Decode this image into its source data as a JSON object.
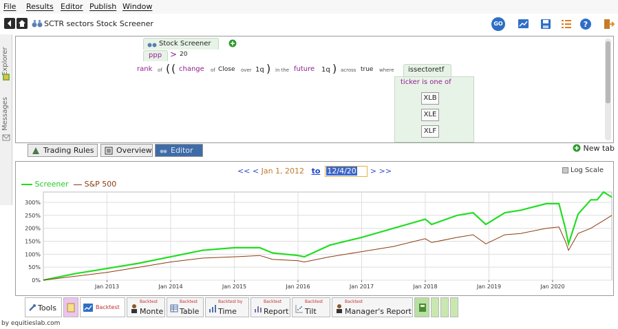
{
  "menu": {
    "items": [
      {
        "label": "File"
      },
      {
        "label": "Results"
      },
      {
        "label": "Editor"
      },
      {
        "label": "Publish"
      },
      {
        "label": "Window"
      }
    ]
  },
  "titlebar": {
    "title": "SCTR sectors Stock Screener",
    "go_label": "GO",
    "icons": [
      "chart-icon",
      "save-icon",
      "list-icon",
      "help-icon",
      "exit-icon"
    ]
  },
  "side_tabs": {
    "explorer": "Explorer",
    "messages": "Messages"
  },
  "editor": {
    "root_label": "Stock Screener",
    "filter_var": "ppp",
    "filter_op": ">",
    "filter_value": "20",
    "rank_word": "rank",
    "of_word": "of",
    "change_word": "change",
    "of_word2": "of",
    "close_word": "Close",
    "over_word": "over",
    "period1": "1q",
    "in_the_word": "in the",
    "future_word": "future",
    "period2": "1q",
    "across_word": "across",
    "true_word": "true",
    "where_word": "where",
    "is_sector_label": "issectoretf",
    "ticker_is_one_of": "ticker is one of",
    "tickers": [
      "XLB",
      "XLE",
      "XLF"
    ]
  },
  "editor_tabs": {
    "trading_rules": "Trading Rules",
    "overview": "Overview",
    "editor": "Editor",
    "new_tab": "New tab",
    "active": "Editor"
  },
  "chart_nav": {
    "prev": "<< <",
    "start_date": "Jan 1, 2012",
    "to": "to",
    "end_date": "12/4/20",
    "next": "> >>",
    "log_scale": "Log Scale"
  },
  "tools_tabs": {
    "tools": "Tools",
    "backtest": "Backtest",
    "items": [
      {
        "caption": "Backtest",
        "label": "Monte"
      },
      {
        "caption": "Backtest",
        "label": "Table"
      },
      {
        "caption": "Backtest by",
        "label": "Time"
      },
      {
        "caption": "Backtest",
        "label": "Report"
      },
      {
        "caption": "Backtest",
        "label": "Tilt"
      },
      {
        "caption": "Backtest",
        "label": "Manager's Report"
      }
    ]
  },
  "credit": "by equitieslab.com",
  "colors": {
    "screener": "#22dd22",
    "sp500": "#8b3a0f",
    "active_tab": "#3f6ca7",
    "purple_text": "#8e1f8e"
  },
  "chart_data": {
    "type": "line",
    "title": "",
    "xlabel": "",
    "ylabel": "",
    "ylim": [
      0,
      340
    ],
    "yticks": [
      "0%",
      "50%",
      "100%",
      "150%",
      "200%",
      "250%",
      "300%"
    ],
    "ytick_values": [
      0,
      50,
      100,
      150,
      200,
      250,
      300
    ],
    "xticks": [
      "Jan 2013",
      "Jan 2014",
      "Jan 2015",
      "Jan 2016",
      "Jan 2017",
      "Jan 2018",
      "Jan 2019",
      "Jan 2020"
    ],
    "xtick_values": [
      2013,
      2014,
      2015,
      2016,
      2017,
      2018,
      2019,
      2020
    ],
    "xlim": [
      2012.0,
      2020.93
    ],
    "grid": true,
    "legend_position": "top-left",
    "series": [
      {
        "name": "Screener",
        "color": "#22dd22",
        "x": [
          2012.0,
          2012.5,
          2013.0,
          2013.5,
          2014.0,
          2014.5,
          2015.0,
          2015.4,
          2015.6,
          2016.0,
          2016.1,
          2016.5,
          2017.0,
          2017.5,
          2018.0,
          2018.1,
          2018.5,
          2018.75,
          2018.95,
          2019.25,
          2019.5,
          2019.9,
          2020.1,
          2020.2,
          2020.25,
          2020.4,
          2020.6,
          2020.7,
          2020.8,
          2020.93
        ],
        "values": [
          0,
          25,
          45,
          65,
          90,
          115,
          125,
          125,
          105,
          95,
          90,
          135,
          165,
          200,
          235,
          215,
          250,
          260,
          215,
          260,
          270,
          295,
          295,
          200,
          140,
          255,
          310,
          310,
          340,
          320
        ]
      },
      {
        "name": "S&P 500",
        "color": "#8b3a0f",
        "x": [
          2012.0,
          2012.5,
          2013.0,
          2013.5,
          2014.0,
          2014.5,
          2015.0,
          2015.4,
          2015.6,
          2016.0,
          2016.1,
          2016.5,
          2017.0,
          2017.5,
          2018.0,
          2018.1,
          2018.5,
          2018.75,
          2018.95,
          2019.25,
          2019.5,
          2019.9,
          2020.1,
          2020.2,
          2020.25,
          2020.4,
          2020.6,
          2020.7,
          2020.8,
          2020.93
        ],
        "values": [
          0,
          15,
          30,
          50,
          70,
          85,
          90,
          95,
          80,
          75,
          70,
          90,
          110,
          130,
          160,
          145,
          165,
          175,
          140,
          175,
          180,
          200,
          205,
          150,
          115,
          180,
          200,
          215,
          230,
          250
        ]
      }
    ]
  }
}
